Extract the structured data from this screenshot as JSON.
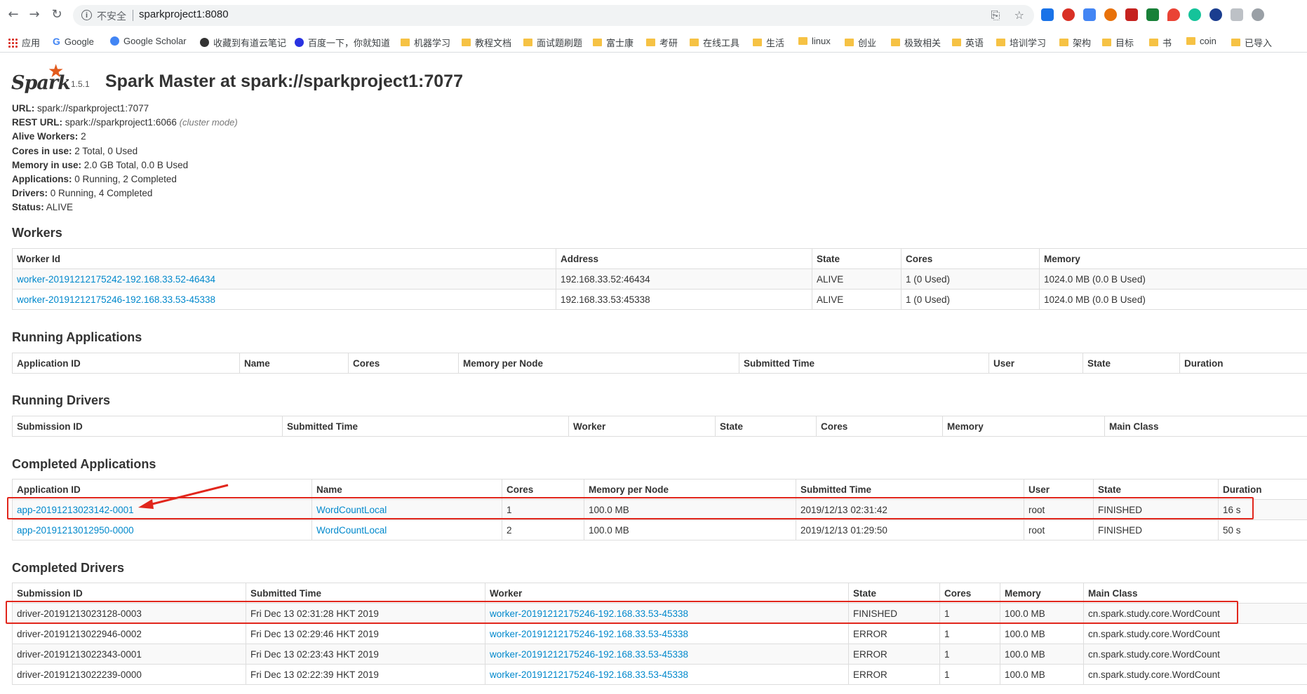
{
  "browser": {
    "omnibox": {
      "insecure_label": "不安全",
      "url": "sparkproject1:8080"
    },
    "bookmarks": [
      {
        "label": "应用",
        "icon": "apps-icon"
      },
      {
        "label": "Google",
        "icon": "google-icon"
      },
      {
        "label": "Google Scholar",
        "icon": "scholar-icon"
      },
      {
        "label": "收藏到有道云笔记",
        "icon": "youdao-icon"
      },
      {
        "label": "百度一下，你就知道",
        "icon": "baidu-icon"
      },
      {
        "label": "机器学习",
        "icon": "folder-icon"
      },
      {
        "label": "教程文档",
        "icon": "folder-icon"
      },
      {
        "label": "面试题刷题",
        "icon": "folder-icon"
      },
      {
        "label": "富士康",
        "icon": "folder-icon"
      },
      {
        "label": "考研",
        "icon": "folder-icon"
      },
      {
        "label": "在线工具",
        "icon": "folder-icon"
      },
      {
        "label": "生活",
        "icon": "folder-icon"
      },
      {
        "label": "linux",
        "icon": "folder-icon"
      },
      {
        "label": "创业",
        "icon": "folder-icon"
      },
      {
        "label": "极致相关",
        "icon": "folder-icon"
      },
      {
        "label": "英语",
        "icon": "folder-icon"
      },
      {
        "label": "培训学习",
        "icon": "folder-icon"
      },
      {
        "label": "架构",
        "icon": "folder-icon"
      },
      {
        "label": "目标",
        "icon": "folder-icon"
      },
      {
        "label": "书",
        "icon": "folder-icon"
      },
      {
        "label": "coin",
        "icon": "folder-icon"
      },
      {
        "label": "已导入",
        "icon": "folder-icon"
      }
    ]
  },
  "header": {
    "logo_text": "Spark",
    "version": "1.5.1",
    "title": "Spark Master at spark://sparkproject1:7077"
  },
  "summary": {
    "url_label": "URL:",
    "url_value": "spark://sparkproject1:7077",
    "rest_label": "REST URL:",
    "rest_value": "spark://sparkproject1:6066",
    "rest_mode": "(cluster mode)",
    "workers_label": "Alive Workers:",
    "workers_value": "2",
    "cores_label": "Cores in use:",
    "cores_value": "2 Total, 0 Used",
    "memory_label": "Memory in use:",
    "memory_value": "2.0 GB Total, 0.0 B Used",
    "apps_label": "Applications:",
    "apps_value": "0 Running, 2 Completed",
    "drivers_label": "Drivers:",
    "drivers_value": "0 Running, 4 Completed",
    "status_label": "Status:",
    "status_value": "ALIVE"
  },
  "workers": {
    "title": "Workers",
    "columns": [
      "Worker Id",
      "Address",
      "State",
      "Cores",
      "Memory"
    ],
    "rows": [
      [
        "worker-20191212175242-192.168.33.52-46434",
        "192.168.33.52:46434",
        "ALIVE",
        "1 (0 Used)",
        "1024.0 MB (0.0 B Used)"
      ],
      [
        "worker-20191212175246-192.168.33.53-45338",
        "192.168.33.53:45338",
        "ALIVE",
        "1 (0 Used)",
        "1024.0 MB (0.0 B Used)"
      ]
    ]
  },
  "running_apps": {
    "title": "Running Applications",
    "columns": [
      "Application ID",
      "Name",
      "Cores",
      "Memory per Node",
      "Submitted Time",
      "User",
      "State",
      "Duration"
    ]
  },
  "running_drivers": {
    "title": "Running Drivers",
    "columns": [
      "Submission ID",
      "Submitted Time",
      "Worker",
      "State",
      "Cores",
      "Memory",
      "Main Class"
    ]
  },
  "completed_apps": {
    "title": "Completed Applications",
    "columns": [
      "Application ID",
      "Name",
      "Cores",
      "Memory per Node",
      "Submitted Time",
      "User",
      "State",
      "Duration"
    ],
    "rows": [
      [
        "app-20191213023142-0001",
        "WordCountLocal",
        "1",
        "100.0 MB",
        "2019/12/13 02:31:42",
        "root",
        "FINISHED",
        "16 s"
      ],
      [
        "app-20191213012950-0000",
        "WordCountLocal",
        "2",
        "100.0 MB",
        "2019/12/13 01:29:50",
        "root",
        "FINISHED",
        "50 s"
      ]
    ]
  },
  "completed_drivers": {
    "title": "Completed Drivers",
    "columns": [
      "Submission ID",
      "Submitted Time",
      "Worker",
      "State",
      "Cores",
      "Memory",
      "Main Class"
    ],
    "rows": [
      [
        "driver-20191213023128-0003",
        "Fri Dec 13 02:31:28 HKT 2019",
        "worker-20191212175246-192.168.33.53-45338",
        "FINISHED",
        "1",
        "100.0 MB",
        "cn.spark.study.core.WordCount"
      ],
      [
        "driver-20191213022946-0002",
        "Fri Dec 13 02:29:46 HKT 2019",
        "worker-20191212175246-192.168.33.53-45338",
        "ERROR",
        "1",
        "100.0 MB",
        "cn.spark.study.core.WordCount"
      ],
      [
        "driver-20191213022343-0001",
        "Fri Dec 13 02:23:43 HKT 2019",
        "worker-20191212175246-192.168.33.53-45338",
        "ERROR",
        "1",
        "100.0 MB",
        "cn.spark.study.core.WordCount"
      ],
      [
        "driver-20191213022239-0000",
        "Fri Dec 13 02:22:39 HKT 2019",
        "worker-20191212175246-192.168.33.53-45338",
        "ERROR",
        "1",
        "100.0 MB",
        "cn.spark.study.core.WordCount"
      ]
    ]
  },
  "colors": {
    "link": "#0088cc",
    "annotation": "#e1261c",
    "spark_orange": "#e25a1c"
  }
}
